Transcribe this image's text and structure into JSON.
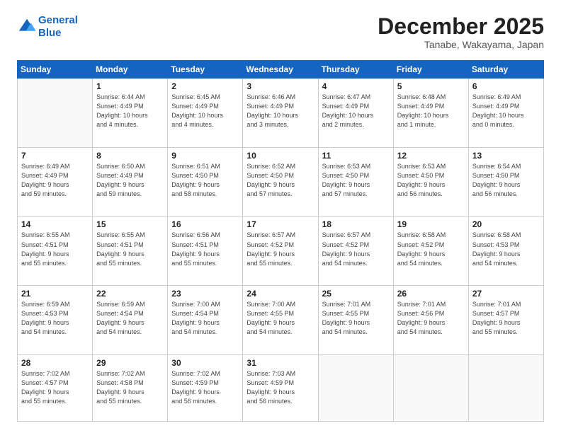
{
  "logo": {
    "line1": "General",
    "line2": "Blue"
  },
  "title": "December 2025",
  "location": "Tanabe, Wakayama, Japan",
  "weekdays": [
    "Sunday",
    "Monday",
    "Tuesday",
    "Wednesday",
    "Thursday",
    "Friday",
    "Saturday"
  ],
  "weeks": [
    [
      {
        "day": "",
        "info": ""
      },
      {
        "day": "1",
        "info": "Sunrise: 6:44 AM\nSunset: 4:49 PM\nDaylight: 10 hours\nand 4 minutes."
      },
      {
        "day": "2",
        "info": "Sunrise: 6:45 AM\nSunset: 4:49 PM\nDaylight: 10 hours\nand 4 minutes."
      },
      {
        "day": "3",
        "info": "Sunrise: 6:46 AM\nSunset: 4:49 PM\nDaylight: 10 hours\nand 3 minutes."
      },
      {
        "day": "4",
        "info": "Sunrise: 6:47 AM\nSunset: 4:49 PM\nDaylight: 10 hours\nand 2 minutes."
      },
      {
        "day": "5",
        "info": "Sunrise: 6:48 AM\nSunset: 4:49 PM\nDaylight: 10 hours\nand 1 minute."
      },
      {
        "day": "6",
        "info": "Sunrise: 6:49 AM\nSunset: 4:49 PM\nDaylight: 10 hours\nand 0 minutes."
      }
    ],
    [
      {
        "day": "7",
        "info": "Sunrise: 6:49 AM\nSunset: 4:49 PM\nDaylight: 9 hours\nand 59 minutes."
      },
      {
        "day": "8",
        "info": "Sunrise: 6:50 AM\nSunset: 4:49 PM\nDaylight: 9 hours\nand 59 minutes."
      },
      {
        "day": "9",
        "info": "Sunrise: 6:51 AM\nSunset: 4:50 PM\nDaylight: 9 hours\nand 58 minutes."
      },
      {
        "day": "10",
        "info": "Sunrise: 6:52 AM\nSunset: 4:50 PM\nDaylight: 9 hours\nand 57 minutes."
      },
      {
        "day": "11",
        "info": "Sunrise: 6:53 AM\nSunset: 4:50 PM\nDaylight: 9 hours\nand 57 minutes."
      },
      {
        "day": "12",
        "info": "Sunrise: 6:53 AM\nSunset: 4:50 PM\nDaylight: 9 hours\nand 56 minutes."
      },
      {
        "day": "13",
        "info": "Sunrise: 6:54 AM\nSunset: 4:50 PM\nDaylight: 9 hours\nand 56 minutes."
      }
    ],
    [
      {
        "day": "14",
        "info": "Sunrise: 6:55 AM\nSunset: 4:51 PM\nDaylight: 9 hours\nand 55 minutes."
      },
      {
        "day": "15",
        "info": "Sunrise: 6:55 AM\nSunset: 4:51 PM\nDaylight: 9 hours\nand 55 minutes."
      },
      {
        "day": "16",
        "info": "Sunrise: 6:56 AM\nSunset: 4:51 PM\nDaylight: 9 hours\nand 55 minutes."
      },
      {
        "day": "17",
        "info": "Sunrise: 6:57 AM\nSunset: 4:52 PM\nDaylight: 9 hours\nand 55 minutes."
      },
      {
        "day": "18",
        "info": "Sunrise: 6:57 AM\nSunset: 4:52 PM\nDaylight: 9 hours\nand 54 minutes."
      },
      {
        "day": "19",
        "info": "Sunrise: 6:58 AM\nSunset: 4:52 PM\nDaylight: 9 hours\nand 54 minutes."
      },
      {
        "day": "20",
        "info": "Sunrise: 6:58 AM\nSunset: 4:53 PM\nDaylight: 9 hours\nand 54 minutes."
      }
    ],
    [
      {
        "day": "21",
        "info": "Sunrise: 6:59 AM\nSunset: 4:53 PM\nDaylight: 9 hours\nand 54 minutes."
      },
      {
        "day": "22",
        "info": "Sunrise: 6:59 AM\nSunset: 4:54 PM\nDaylight: 9 hours\nand 54 minutes."
      },
      {
        "day": "23",
        "info": "Sunrise: 7:00 AM\nSunset: 4:54 PM\nDaylight: 9 hours\nand 54 minutes."
      },
      {
        "day": "24",
        "info": "Sunrise: 7:00 AM\nSunset: 4:55 PM\nDaylight: 9 hours\nand 54 minutes."
      },
      {
        "day": "25",
        "info": "Sunrise: 7:01 AM\nSunset: 4:55 PM\nDaylight: 9 hours\nand 54 minutes."
      },
      {
        "day": "26",
        "info": "Sunrise: 7:01 AM\nSunset: 4:56 PM\nDaylight: 9 hours\nand 54 minutes."
      },
      {
        "day": "27",
        "info": "Sunrise: 7:01 AM\nSunset: 4:57 PM\nDaylight: 9 hours\nand 55 minutes."
      }
    ],
    [
      {
        "day": "28",
        "info": "Sunrise: 7:02 AM\nSunset: 4:57 PM\nDaylight: 9 hours\nand 55 minutes."
      },
      {
        "day": "29",
        "info": "Sunrise: 7:02 AM\nSunset: 4:58 PM\nDaylight: 9 hours\nand 55 minutes."
      },
      {
        "day": "30",
        "info": "Sunrise: 7:02 AM\nSunset: 4:59 PM\nDaylight: 9 hours\nand 56 minutes."
      },
      {
        "day": "31",
        "info": "Sunrise: 7:03 AM\nSunset: 4:59 PM\nDaylight: 9 hours\nand 56 minutes."
      },
      {
        "day": "",
        "info": ""
      },
      {
        "day": "",
        "info": ""
      },
      {
        "day": "",
        "info": ""
      }
    ]
  ]
}
